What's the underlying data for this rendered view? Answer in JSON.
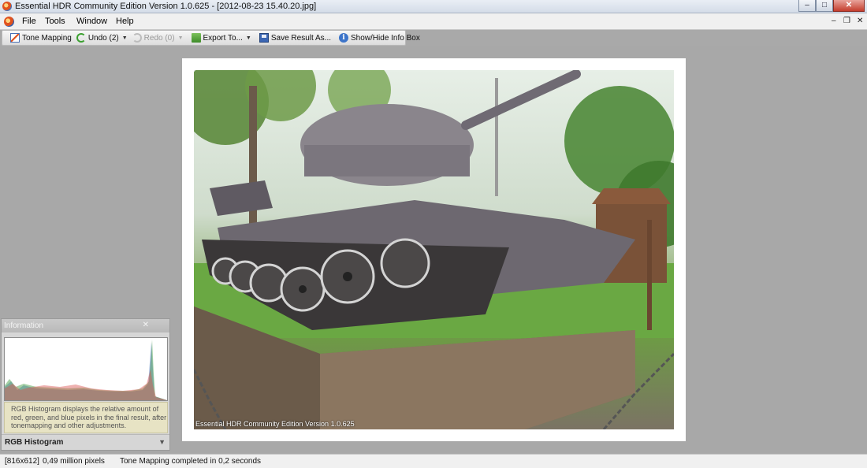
{
  "window": {
    "title": "Essential HDR Community Edition Version 1.0.625 - [2012-08-23 15.40.20.jpg]",
    "controls": {
      "minimize": "‒",
      "maximize": "□",
      "close": "✕"
    }
  },
  "menubar": {
    "items": [
      {
        "label": "File",
        "underline": "F"
      },
      {
        "label": "Tools",
        "underline": "T"
      },
      {
        "label": "Window",
        "underline": "W"
      },
      {
        "label": "Help",
        "underline": "H"
      }
    ],
    "mdi_controls": {
      "minimize": "–",
      "restore": "❐",
      "close": "✕"
    }
  },
  "toolbar": {
    "tone_mapping": "Tone Mapping",
    "undo": "Undo (2)",
    "redo": "Redo (0)",
    "export": "Export To...",
    "save": "Save Result As...",
    "info_box": "Show/Hide Info Box",
    "dropdown_arrow": "▼"
  },
  "image": {
    "watermark": "Essential HDR Community Edition Version 1.0.625"
  },
  "info_panel": {
    "title": "Information",
    "close": "✕",
    "histogram_description": "RGB Histogram displays the relative amount of red, green, and blue pixels in the final result, after tonemapping and other adjustments.",
    "footer_label": "RGB Histogram",
    "footer_button": "▼"
  },
  "status": {
    "dimensions": "[816x612]",
    "pixels": "0,49 million pixels",
    "message": "Tone Mapping completed in 0,2 seconds"
  },
  "colors": {
    "workspace": "#a8a8a8",
    "histogram_red": "#d9534f",
    "histogram_green": "#3a9a3a",
    "histogram_blue": "#4a6fd0"
  }
}
